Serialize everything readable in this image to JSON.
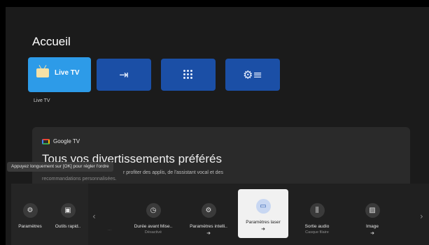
{
  "home": {
    "title": "Accueil"
  },
  "tiles": [
    {
      "name": "live-tv",
      "label": "Live TV",
      "caption": "Live TV",
      "icon": "tv-icon"
    },
    {
      "name": "input-source",
      "icon": "input-icon"
    },
    {
      "name": "apps",
      "icon": "apps-grid-icon"
    },
    {
      "name": "settings",
      "icon": "settings-list-icon"
    }
  ],
  "google_tv": {
    "brand": "Google TV",
    "headline": "Tous vos divertissements préférés",
    "sub_line1": "r profiter des applis, de l'assistant vocal et des",
    "sub_line2": "recommandations personnalisées."
  },
  "tooltip": "Appuyez longuement sur [OK] pour régler l'ordre",
  "quick_settings": {
    "pinned": [
      {
        "name": "settings",
        "label": "Paramètres",
        "icon": "gear-icon"
      },
      {
        "name": "quick-tools",
        "label": "Outils rapid..",
        "icon": "toolbox-icon"
      }
    ],
    "faded_text": "...",
    "items": [
      {
        "name": "sleep-timer",
        "label": "Durée avant Mise..",
        "sub": "Désactivé",
        "icon": "timer-icon"
      },
      {
        "name": "smart-settings",
        "label": "Paramètres intelli..",
        "arrow": "➜",
        "icon": "smart-gear-icon"
      },
      {
        "name": "laser-settings",
        "label": "Paramètres laser",
        "arrow": "➜",
        "icon": "laser-icon",
        "active": true
      },
      {
        "name": "audio-output",
        "label": "Sortie audio",
        "sub": "Casque filaire",
        "icon": "audio-icon"
      },
      {
        "name": "image",
        "label": "Image",
        "arrow": "➜",
        "icon": "image-icon"
      }
    ]
  },
  "colors": {
    "tile_blue": "#1b4fa6",
    "tile_focused": "#2d9be8",
    "active_chip": "#f1f1f1"
  }
}
